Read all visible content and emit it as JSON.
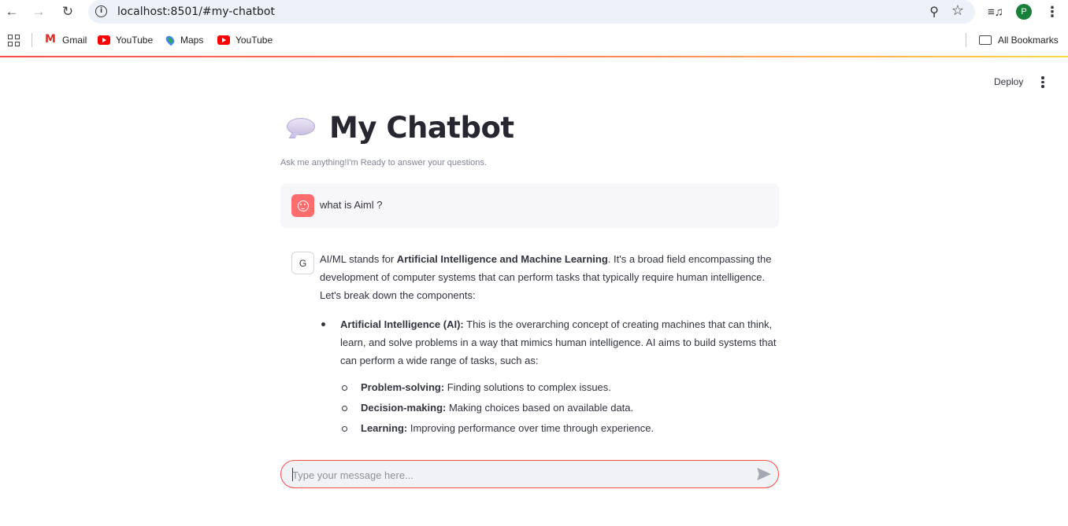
{
  "browser": {
    "url": "localhost:8501/#my-chatbot",
    "profile_initial": "P",
    "bookmarks": [
      {
        "label": "Gmail",
        "icon": "gmail-icon"
      },
      {
        "label": "YouTube",
        "icon": "youtube-icon"
      },
      {
        "label": "Maps",
        "icon": "maps-icon"
      },
      {
        "label": "YouTube",
        "icon": "youtube-icon"
      }
    ],
    "all_bookmarks": "All Bookmarks"
  },
  "app": {
    "deploy_label": "Deploy",
    "title": "My Chatbot",
    "subtitle": "Ask me anything!I'm Ready to answer your questions.",
    "accent_color": "#ff4b4b"
  },
  "chat": {
    "user_message": "what is Aiml ?",
    "bot_avatar_letter": "G",
    "bot_intro_pre": "AI/ML stands for ",
    "bot_intro_bold": "Artificial Intelligence and Machine Learning",
    "bot_intro_post": ". It's a broad field encompassing the development of computer systems that can perform tasks that typically require human intelligence. Let's break down the components:",
    "ai_bold": "Artificial Intelligence (AI):",
    "ai_text": " This is the overarching concept of creating machines that can think, learn, and solve problems in a way that mimics human intelligence. AI aims to build systems that can perform a wide range of tasks, such as:",
    "subitems": [
      {
        "bold": "Problem-solving:",
        "text": " Finding solutions to complex issues."
      },
      {
        "bold": "Decision-making:",
        "text": " Making choices based on available data."
      },
      {
        "bold": "Learning:",
        "text": " Improving performance over time through experience."
      }
    ]
  },
  "input": {
    "placeholder": "Type your message here..."
  }
}
